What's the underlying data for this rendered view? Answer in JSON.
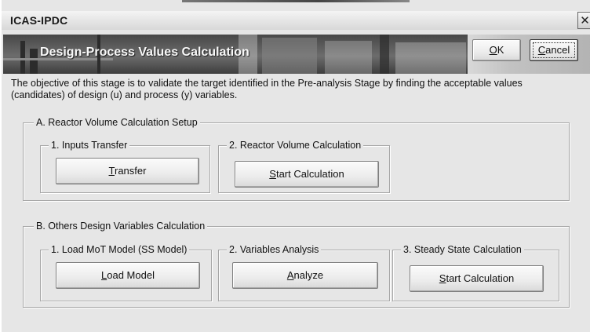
{
  "window": {
    "title": "ICAS-IPDC",
    "close_glyph": "✕"
  },
  "banner": {
    "title": "Design-Process Values Calculation"
  },
  "dialog_buttons": {
    "ok": {
      "mnemonic": "O",
      "rest": "K"
    },
    "cancel": {
      "mnemonic": "C",
      "rest": "ancel"
    }
  },
  "objective": {
    "line1": "The objective of this stage is to validate the target identified in the Pre-analysis Stage by finding the acceptable values",
    "line2": "(candidates) of design (u) and process (y) variables."
  },
  "section_a": {
    "title": "A. Reactor Volume Calculation Setup",
    "groups": [
      {
        "title": "1. Inputs Transfer",
        "button": {
          "mnemonic": "T",
          "rest": "ransfer"
        }
      },
      {
        "title": "2. Reactor Volume Calculation",
        "button": {
          "mnemonic": "S",
          "rest": "tart Calculation"
        }
      }
    ]
  },
  "section_b": {
    "title": "B. Others Design Variables Calculation",
    "groups": [
      {
        "title": "1. Load MoT Model (SS Model)",
        "button": {
          "mnemonic": "L",
          "rest": "oad Model"
        }
      },
      {
        "title": "2. Variables Analysis",
        "button": {
          "mnemonic": "A",
          "rest": "nalyze"
        }
      },
      {
        "title": "3. Steady State Calculation",
        "button": {
          "mnemonic": "S",
          "rest": "tart Calculation"
        }
      }
    ]
  }
}
